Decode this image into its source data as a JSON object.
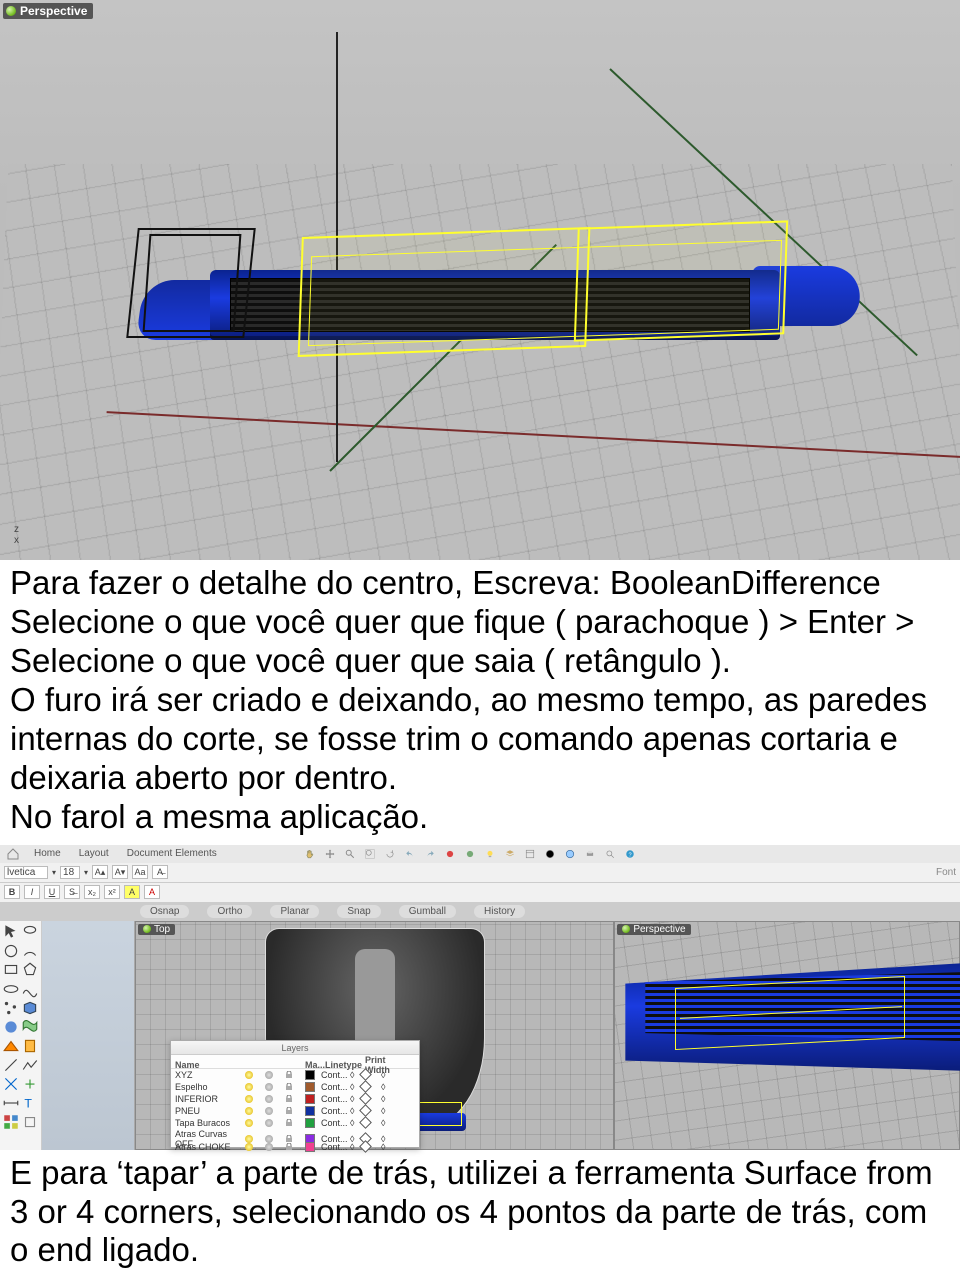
{
  "viewport1": {
    "label": "Perspective",
    "gizmo": "z\nx"
  },
  "paragraph1": "Para fazer o detalhe do centro, Escreva: BooleanDifference Selecione o que você quer que fique ( parachoque ) > Enter > Selecione o que você quer que saia ( retângulo ).\nO furo irá ser criado e deixando, ao mesmo tempo, as paredes internas do corte, se fosse trim o comando apenas cortaria e deixaria aberto por dentro.\nNo farol a mesma aplicação.",
  "app": {
    "tabs": [
      "Home",
      "Layout",
      "Document Elements"
    ],
    "font_label": "Font",
    "font_name": "lvetica",
    "font_size": "18",
    "snap": [
      "Osnap",
      "Ortho",
      "Planar",
      "Snap",
      "Gumball",
      "History"
    ],
    "viewTop": "Top",
    "viewPersp": "Perspective",
    "layers_panel": {
      "title": "Layers",
      "columns": [
        "Name",
        "",
        "Ma...",
        "Linetype",
        "Print Width"
      ],
      "rows": [
        {
          "name": "XYZ",
          "color": "#000000",
          "linetype": "Cont... ◊",
          "print": "◊"
        },
        {
          "name": "Espelho",
          "color": "#a05a2c",
          "linetype": "Cont... ◊",
          "print": "◊"
        },
        {
          "name": "INFERIOR",
          "color": "#c02020",
          "linetype": "Cont... ◊",
          "print": "◊"
        },
        {
          "name": "PNEU",
          "color": "#1030a0",
          "linetype": "Cont... ◊",
          "print": "◊"
        },
        {
          "name": "Tapa Buracos",
          "color": "#20a040",
          "linetype": "Cont... ◊",
          "print": "◊"
        },
        {
          "name": "Atras Curvas OFF",
          "color": "#8a2be2",
          "linetype": "Cont... ◊",
          "print": "◊"
        },
        {
          "name": "Atras CHOKE",
          "color": "#f04090",
          "linetype": "Cont... ◊",
          "print": "◊"
        }
      ]
    }
  },
  "paragraph2": "E para ‘tapar’ a parte de trás, utilizei a ferramenta Surface from 3 or 4 corners, selecionando os 4 pontos da parte de trás, com o end ligado."
}
